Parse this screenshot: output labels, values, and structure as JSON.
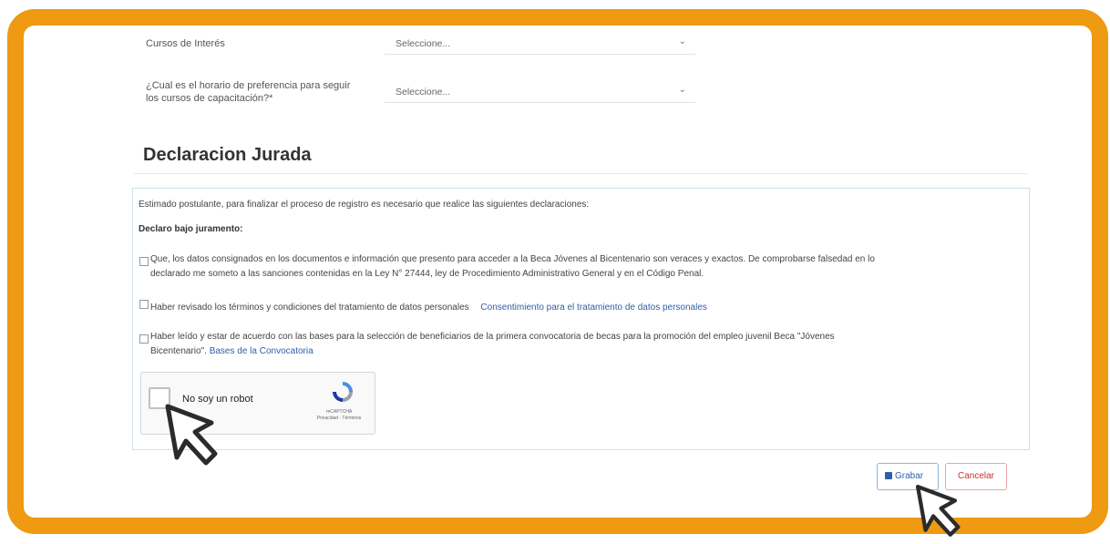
{
  "form": {
    "courses_label": "Cursos de Interés",
    "courses_value": "Seleccione...",
    "schedule_label_line1": "¿Cual es el horario de preferencia para seguir",
    "schedule_label_line2": "los cursos de capacitación?*",
    "schedule_value": "Seleccione..."
  },
  "declaration": {
    "heading": "Declaracion Jurada",
    "intro": "Estimado postulante, para finalizar el proceso de registro es necesario que realice las siguientes declaraciones:",
    "sworn": "Declaro bajo juramento:",
    "item1_line1": "Que, los datos consignados en los documentos e información que presento para acceder a la Beca Jóvenes al Bicentenario son veraces y exactos. De comprobarse falsedad en lo",
    "item1_line2": "declarado me someto a las sanciones contenidas en la Ley N° 27444, ley de Procedimiento Administrativo General y en el Código Penal.",
    "item2_text": "Haber revisado los términos y condiciones del tratamiento de datos personales",
    "item2_link": "Consentimiento para el tratamiento de datos personales",
    "item3_line1": "Haber leído y estar de acuerdo con las bases para la selección de beneficiarios de la primera convocatoria de becas para la promoción del empleo juvenil Beca \"Jóvenes",
    "item3_line2": "Bicentenario\".",
    "item3_link": "Bases de la Convocatoria"
  },
  "recaptcha": {
    "label": "No soy un robot",
    "brand": "reCAPTCHA",
    "links": "Privacidad - Términos"
  },
  "actions": {
    "save_label": "Grabar",
    "cancel_label": "Cancelar"
  },
  "colors": {
    "frame": "#ee9a12",
    "link": "#2f5fa8",
    "cancel": "#c9302c"
  },
  "icons": {
    "save": "floppy-disk-icon",
    "select": "chevron-down-icon",
    "pointer": "cursor-arrow-icon"
  }
}
